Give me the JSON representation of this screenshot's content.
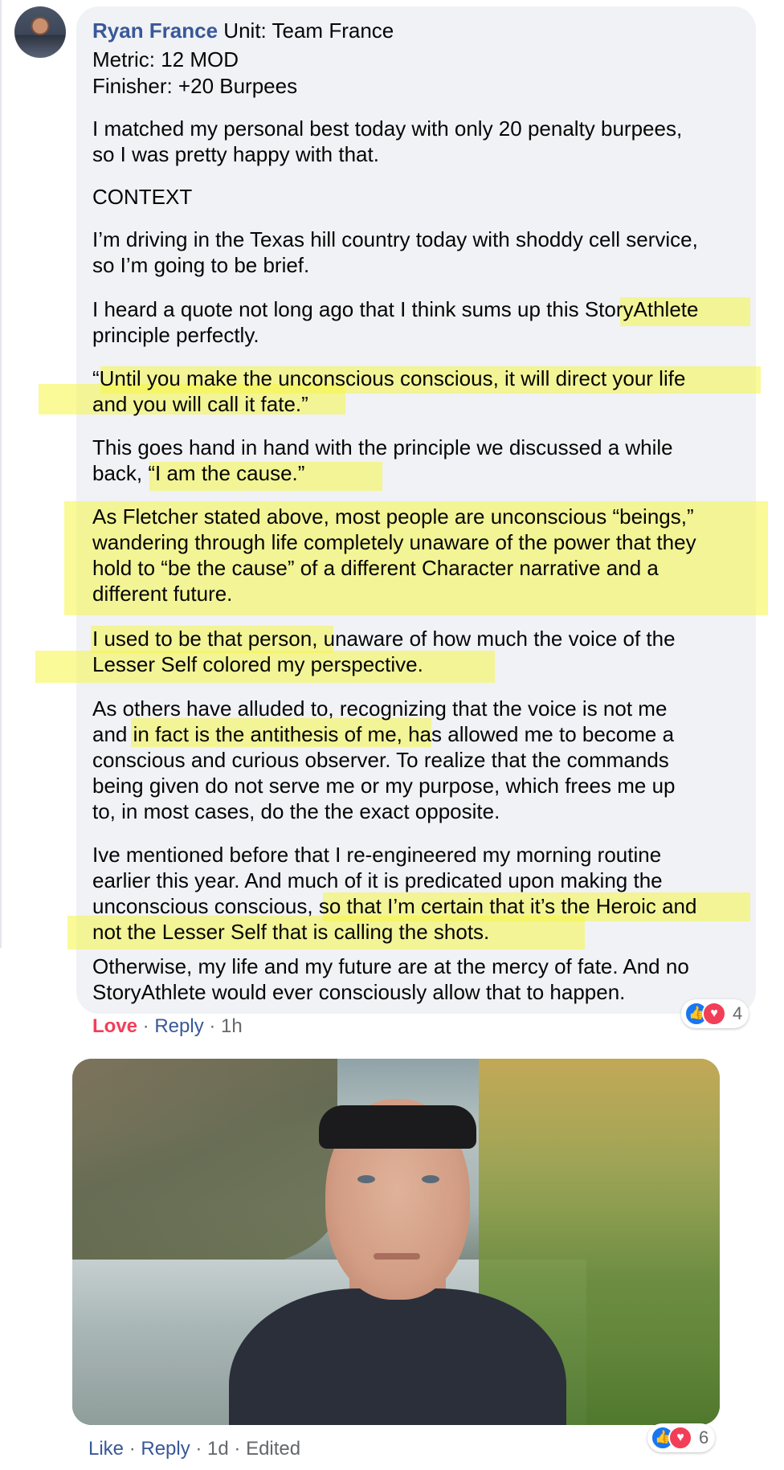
{
  "comment1": {
    "author": "Ryan France",
    "header_rest": " Unit: Team France",
    "lines_meta": [
      "Metric: 12 MOD",
      "Finisher: +20 Burpees"
    ],
    "paragraphs": [
      "I matched my personal best today with only 20 penalty burpees,\nso I was pretty happy with that.",
      "CONTEXT",
      "I’m driving in the Texas hill country today with shoddy cell service,\nso I’m going to be brief.",
      "I heard a quote not long ago that I think sums up this StoryAthlete\nprinciple perfectly.",
      "“Until you make the unconscious conscious, it will direct your life\nand you will call it fate.”",
      "This goes hand in hand with the principle we discussed a while\nback, “I am the cause.”",
      "As Fletcher stated above, most people are unconscious “beings,”\nwandering through life completely unaware of the power that they\nhold to “be the cause” of a different Character narrative and a\ndifferent future.",
      "I used to be that person, unaware of how much the voice of the\nLesser Self colored my perspective.",
      "As others have alluded to, recognizing that the voice is not me\nand in fact is the antithesis of me, has allowed me to become a\nconscious and curious observer. To realize that the commands\nbeing given do not serve me or my purpose, which frees me up\nto, in most cases, do the the exact opposite.",
      "Ive mentioned before that I re-engineered my morning routine\nearlier this year. And much of it is predicated upon making the\nunconscious conscious, so that I’m certain that it’s the Heroic and\nnot the Lesser Self that is calling the shots.",
      "Otherwise, my life and my future are at the mercy of fate. And no\nStoryAthlete would ever consciously allow that to happen."
    ],
    "actions": {
      "love": "Love",
      "reply": "Reply",
      "time": "1h",
      "sep": " · "
    },
    "reactions": {
      "like_glyph": "👍",
      "love_glyph": "♥",
      "count": "4"
    }
  },
  "comment2": {
    "video_alt": "Video of man wearing a headband by a river",
    "actions": {
      "like": "Like",
      "reply": "Reply",
      "time": "1d",
      "edited": "Edited",
      "sep": " · "
    },
    "reactions": {
      "like_glyph": "👍",
      "love_glyph": "♥",
      "count": "6"
    }
  },
  "colors": {
    "bubble_bg": "#f0f2f5",
    "author_link": "#385898",
    "love": "#f33e58",
    "like_blue": "#1877f2",
    "highlight": "#f5f546"
  }
}
